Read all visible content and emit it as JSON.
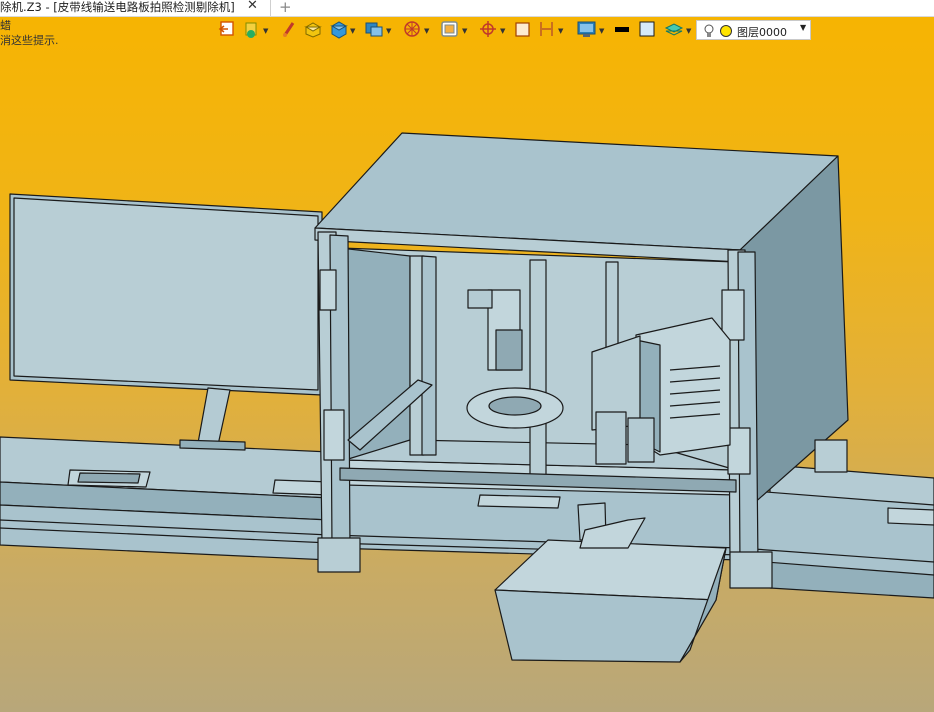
{
  "tab": {
    "title": "除机.Z3 - [皮带线输送电路板拍照检测剔除机]",
    "close_glyph": "✕",
    "add_glyph": "+"
  },
  "hint": {
    "line1": "蜡",
    "line2": "消这些提示."
  },
  "toolbar": {
    "icons": [
      "exit-icon",
      "paint-icon",
      "brush-icon",
      "block-icon",
      "box-icon",
      "shape-icon",
      "wheel-icon",
      "frame-icon",
      "target-icon",
      "square-icon",
      "bracket-icon",
      "display-icon",
      "line-icon",
      "color-icon",
      "layer-stack-icon"
    ]
  },
  "layer_selector": {
    "value": "图层0000",
    "bulb_icon": "bulb-icon",
    "color_swatch": "#ffe400"
  },
  "colors": {
    "model_fill": "#a9c3cd",
    "model_dark": "#7b98a3",
    "model_light": "#c2d6dc",
    "outline": "#1a1a1a"
  }
}
